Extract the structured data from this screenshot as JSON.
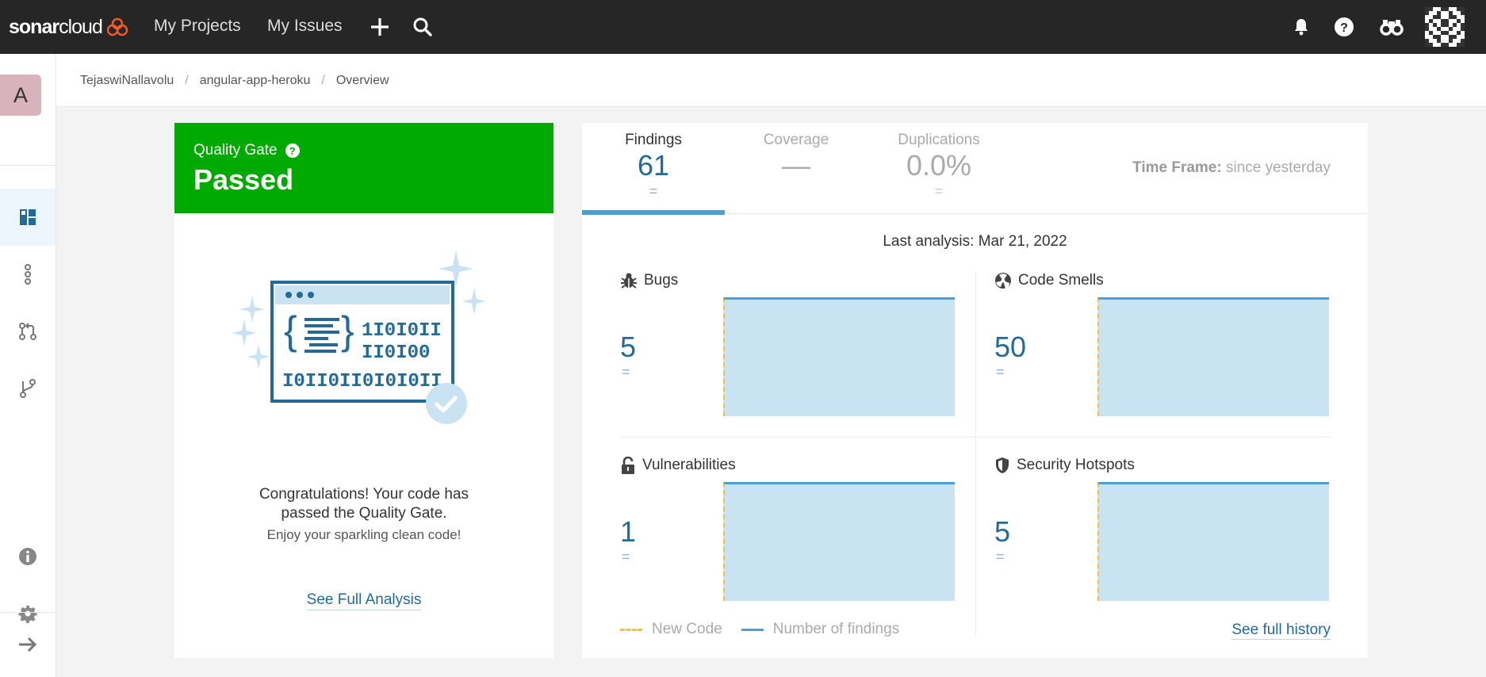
{
  "topbar": {
    "logo_bold": "sonar",
    "logo_light": "cloud",
    "links": [
      "My Projects",
      "My Issues"
    ],
    "icons": [
      "plus-icon",
      "search-icon",
      "bell-icon",
      "help-icon",
      "binoculars-icon",
      "user-avatar"
    ]
  },
  "sidebar": {
    "project_initial": "A",
    "items": [
      "overview-icon",
      "branches-graph-icon",
      "pull-requests-icon",
      "branch-icon",
      "info-icon",
      "settings-icon",
      "expand-arrow-icon"
    ]
  },
  "breadcrumb": {
    "org": "TejaswiNallavolu",
    "project": "angular-app-heroku",
    "page": "Overview",
    "separator": "/"
  },
  "quality_gate": {
    "label": "Quality Gate",
    "help": "?",
    "status": "Passed",
    "status_color": "#00aa00",
    "message_line1": "Congratulations! Your code has",
    "message_line2": "passed the Quality Gate.",
    "sub_message": "Enjoy your sparkling clean code!",
    "link": "See Full Analysis"
  },
  "tabs": [
    {
      "label": "Findings",
      "value": "61",
      "delta": "="
    },
    {
      "label": "Coverage",
      "value": "—",
      "delta": ""
    },
    {
      "label": "Duplications",
      "value": "0.0%",
      "delta": "="
    }
  ],
  "timeframe": {
    "label": "Time Frame:",
    "value": "since yesterday"
  },
  "last_analysis": "Last analysis: Mar 21, 2022",
  "metrics": {
    "bugs": {
      "label": "Bugs",
      "value": "5",
      "delta": "="
    },
    "code_smells": {
      "label": "Code Smells",
      "value": "50",
      "delta": "="
    },
    "vulnerabilities": {
      "label": "Vulnerabilities",
      "value": "1",
      "delta": "="
    },
    "security_hotspots": {
      "label": "Security Hotspots",
      "value": "5",
      "delta": "="
    }
  },
  "legend": {
    "new_code": "New Code",
    "number_of_findings": "Number of findings"
  },
  "full_history_link": "See full history",
  "colors": {
    "topbar": "#262626",
    "passed": "#00aa00",
    "accent_blue": "#4b9fd5",
    "value_blue": "#236a97",
    "chart_fill": "#cae3f2",
    "new_code": "#f4c430"
  }
}
